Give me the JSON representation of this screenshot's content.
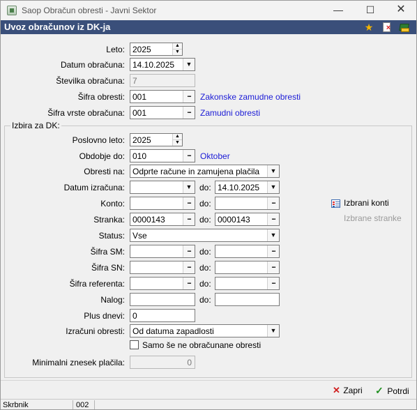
{
  "window": {
    "title": "Saop Obračun obresti - Javni Sektor",
    "minimize": "—",
    "maximize": "☐",
    "close": "✕"
  },
  "header": {
    "title": "Uvoz obračunov iz DK-ja"
  },
  "form": {
    "leto": {
      "label": "Leto:",
      "value": "2025"
    },
    "datum_obracuna": {
      "label": "Datum obračuna:",
      "value": "14.10.2025"
    },
    "stevilka_obracuna": {
      "label": "Številka obračuna:",
      "value": "7"
    },
    "sifra_obresti": {
      "label": "Šifra obresti:",
      "value": "001",
      "description": "Zakonske zamudne obresti"
    },
    "sifra_vrste_obracuna": {
      "label": "Šifra vrste obračuna:",
      "value": "001",
      "description": "Zamudni obresti"
    }
  },
  "dk": {
    "group_title": "Izbira za DK:",
    "poslovno_leto": {
      "label": "Poslovno leto:",
      "value": "2025"
    },
    "obdobje_do": {
      "label": "Obdobje do:",
      "value": "010",
      "description": "Oktober"
    },
    "obresti_na": {
      "label": "Obresti na:",
      "value": "Odprte račune in zamujena plačila"
    },
    "datum_izracuna": {
      "label": "Datum izračuna:",
      "from": "",
      "to_label": "do:",
      "to": "14.10.2025"
    },
    "konto": {
      "label": "Konto:",
      "from": "",
      "to_label": "do:",
      "to": ""
    },
    "stranka": {
      "label": "Stranka:",
      "from": "0000143",
      "to_label": "do:",
      "to": "0000143"
    },
    "status": {
      "label": "Status:",
      "value": "Vse"
    },
    "sifra_sm": {
      "label": "Šifra SM:",
      "from": "",
      "to_label": "do:",
      "to": ""
    },
    "sifra_sn": {
      "label": "Šifra SN:",
      "from": "",
      "to_label": "do:",
      "to": ""
    },
    "sifra_referenta": {
      "label": "Šifra referenta:",
      "from": "",
      "to_label": "do:",
      "to": ""
    },
    "nalog": {
      "label": "Nalog:",
      "from": "",
      "to_label": "do:",
      "to": ""
    },
    "plus_dnevi": {
      "label": "Plus dnevi:",
      "value": "0"
    },
    "izracuni_obresti": {
      "label": "Izračuni obresti:",
      "value": "Od datuma zapadlosti"
    },
    "samo_neobracunane": {
      "label": "Samo še ne obračunane obresti",
      "checked": false
    },
    "minimalni_znesek": {
      "label": "Minimalni znesek plačila:",
      "value": "0"
    }
  },
  "side": {
    "izbrani_konti": "Izbrani konti",
    "izbrane_stranke": "Izbrane stranke"
  },
  "buttons": {
    "zapri": "Zapri",
    "potrdi": "Potrdi"
  },
  "status_bar": {
    "user": "Skrbnik",
    "code": "002",
    "message": ""
  },
  "icons": [
    "app-icon",
    "star-icon",
    "document-close-icon",
    "books-icon",
    "list-icon",
    "close-x-icon",
    "checkmark-icon"
  ],
  "colors": {
    "header_bg": "#3a4f7a",
    "link": "#1b1bd6",
    "star": "#f4b400",
    "zapri_icon": "#d01f1f",
    "potrdi_icon": "#1f8f1f"
  }
}
